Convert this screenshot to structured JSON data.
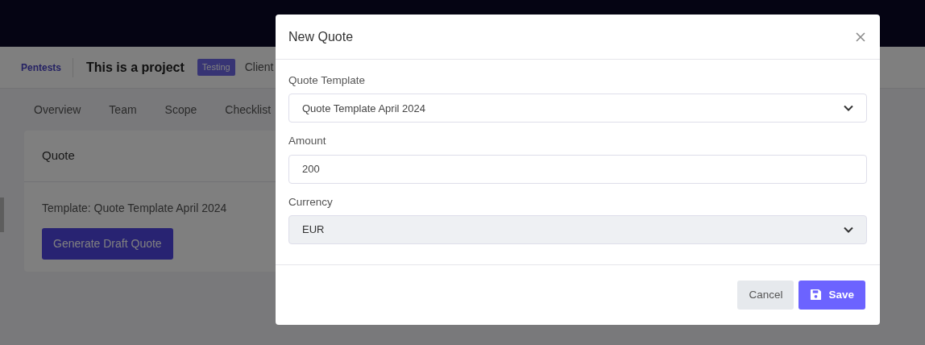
{
  "header": {
    "breadcrumb": "Pentests",
    "project_title": "This is a project",
    "status_badge": "Testing",
    "client_label": "Client"
  },
  "tabs": [
    {
      "label": "Overview",
      "selected": false
    },
    {
      "label": "Team",
      "selected": false
    },
    {
      "label": "Scope",
      "selected": false
    },
    {
      "label": "Checklist",
      "selected": false
    }
  ],
  "quote_card": {
    "title": "Quote",
    "template_text": "Template: Quote Template April 2024",
    "button": "Generate Draft Quote"
  },
  "modal": {
    "title": "New Quote",
    "fields": [
      {
        "kind": "select",
        "label": "Quote Template",
        "value": "Quote Template April 2024",
        "disabled": false
      },
      {
        "kind": "input",
        "label": "Amount",
        "value": "200",
        "disabled": false
      },
      {
        "kind": "select",
        "label": "Currency",
        "value": "EUR",
        "disabled": true
      }
    ],
    "cancel_button": "Cancel",
    "save_button": "Save"
  }
}
